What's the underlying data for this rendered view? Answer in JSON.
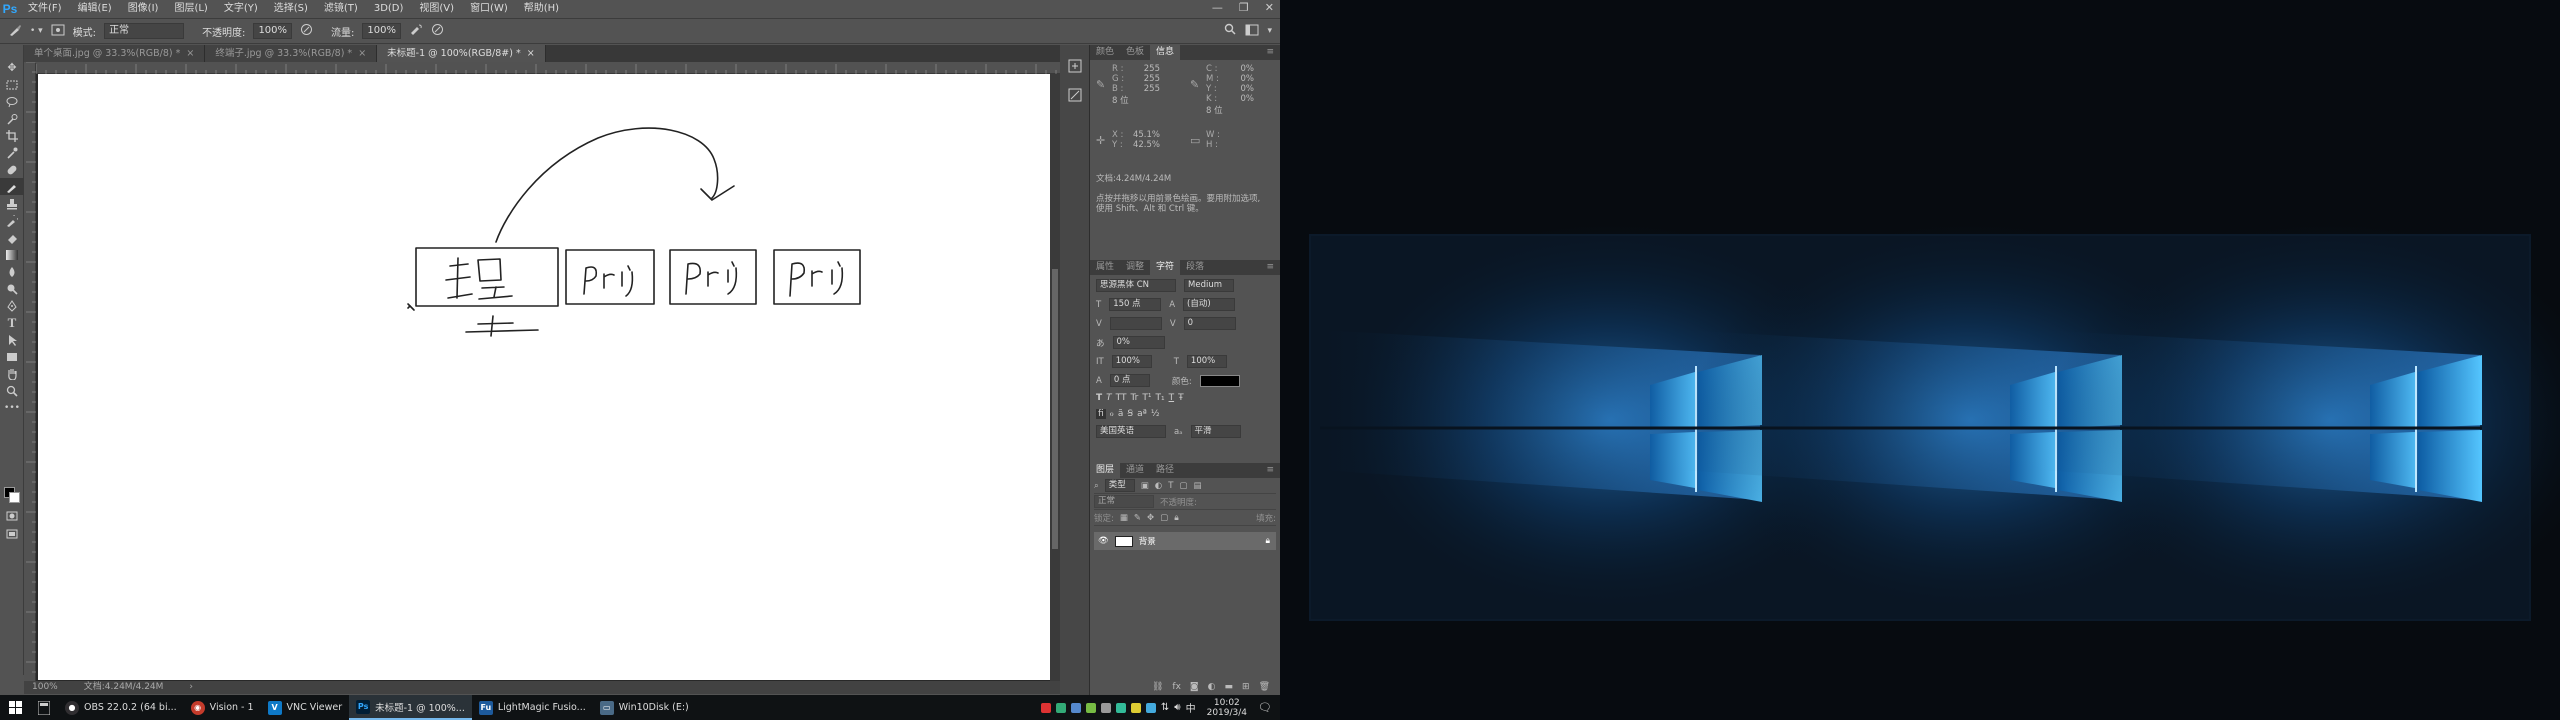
{
  "app": {
    "logo": "Ps"
  },
  "menu": [
    "文件(F)",
    "编辑(E)",
    "图像(I)",
    "图层(L)",
    "文字(Y)",
    "选择(S)",
    "滤镜(T)",
    "3D(D)",
    "视图(V)",
    "窗口(W)",
    "帮助(H)"
  ],
  "window_controls": {
    "minimize": "—",
    "restore": "❐",
    "close": "✕"
  },
  "options": {
    "mode_label": "模式:",
    "mode_value": "正常",
    "opacity_label": "不透明度:",
    "opacity_value": "100%",
    "flow_label": "流量:",
    "flow_value": "100%"
  },
  "tabs": [
    {
      "label": "单个桌面.jpg @ 33.3%(RGB/8) *",
      "close": "×"
    },
    {
      "label": "终端子.jpg @ 33.3%(RGB/8) *",
      "close": "×"
    },
    {
      "label": "未标题-1 @ 100%(RGB/8#) *",
      "close": "×"
    }
  ],
  "status": {
    "zoom": "100%",
    "doc": "文档:4.24M/4.24M"
  },
  "panel_info": {
    "tabs": [
      "颜色",
      "色板",
      "信息"
    ],
    "rgb": [
      {
        "k": "R :",
        "v": "255"
      },
      {
        "k": "G :",
        "v": "255"
      },
      {
        "k": "B :",
        "v": "255"
      }
    ],
    "cmyk": [
      {
        "k": "C :",
        "v": "0%"
      },
      {
        "k": "M :",
        "v": "0%"
      },
      {
        "k": "Y :",
        "v": "0%"
      },
      {
        "k": "K :",
        "v": "0%"
      }
    ],
    "bits1": "8 位",
    "bits2": "8 位",
    "xy": [
      {
        "k": "X :",
        "v": "45.1%"
      },
      {
        "k": "Y :",
        "v": "42.5%"
      }
    ],
    "wh": [
      {
        "k": "W :",
        "v": ""
      },
      {
        "k": "H :",
        "v": ""
      }
    ],
    "doc": "文档:4.24M/4.24M",
    "hint1": "点按并拖移以用前景色绘画。要用附加选项,",
    "hint2": "使用 Shift、Alt 和 Ctrl 键。"
  },
  "panel_char": {
    "tabs": [
      "属性",
      "调整",
      "字符",
      "段落"
    ],
    "font": "思源黑体 CN",
    "weight": "Medium",
    "size": "150 点",
    "leading": "(自动)",
    "kerning": "",
    "tracking": "0",
    "scale_pct": "0%",
    "vscale": "100%",
    "hscale": "100%",
    "baseline": "0 点",
    "color_label": "颜色:",
    "style_buttons": [
      "T",
      "T",
      "TT",
      "Tr",
      "T¹",
      "T₁",
      "T",
      "Ŧ"
    ],
    "language": "美国英语",
    "aa": "aₐ",
    "smoothing": "平滑"
  },
  "panel_layers": {
    "tabs": [
      "图层",
      "通道",
      "路径"
    ],
    "kind": "类型",
    "blend": "正常",
    "opacity_label": "不透明度:",
    "lock_label": "锁定:",
    "fill_label": "填充:",
    "layer_name": "背景"
  },
  "taskbar": {
    "items": [
      {
        "label": "OBS 22.0.2 (64 bi...",
        "icon": "obs-icon",
        "color": "#302e31"
      },
      {
        "label": "Vision - 1",
        "icon": "vision-icon",
        "color": "#c43b2b"
      },
      {
        "label": "VNC Viewer",
        "icon": "vnc-icon",
        "color": "#0e79c7"
      },
      {
        "label": "未标题-1 @ 100%...",
        "icon": "photoshop-icon",
        "color": "#001e36"
      },
      {
        "label": "LightMagic Fusio...",
        "icon": "fusion-icon",
        "color": "#1d5a9c"
      },
      {
        "label": "Win10Disk (E:)",
        "icon": "drive-icon",
        "color": "#4a6a86"
      }
    ],
    "time": "10:02",
    "date": "2019/3/4"
  },
  "colors": {
    "ps_bg": "#535353",
    "accent": "#31a8ff",
    "taskbar": "#0f1214"
  }
}
